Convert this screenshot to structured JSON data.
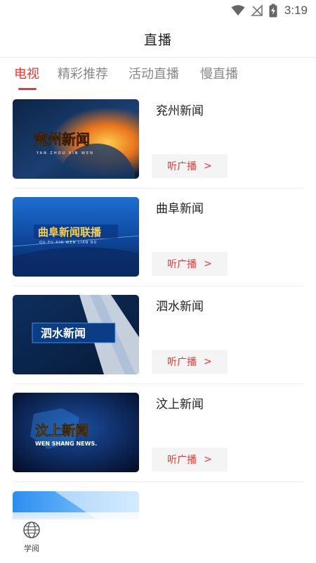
{
  "status_bar": {
    "time": "3:19",
    "icons": [
      "wifi-icon",
      "no-signal-icon",
      "battery-charging-icon"
    ]
  },
  "header": {
    "title": "直播"
  },
  "tabs": [
    {
      "label": "电视",
      "active": true
    },
    {
      "label": "精彩推荐",
      "active": false
    },
    {
      "label": "活动直播",
      "active": false
    },
    {
      "label": "慢直播",
      "active": false
    }
  ],
  "channels": [
    {
      "title": "兖州新闻",
      "thumb_caption": "兖州新闻",
      "thumb_sub": "YAN ZHOU XIN WEN",
      "button_label": "听广播",
      "button_icon": "chevron-right-icon"
    },
    {
      "title": "曲阜新闻",
      "thumb_caption": "曲阜新闻联播",
      "thumb_sub": "QU FU XIN WEN LIAN BO",
      "button_label": "听广播",
      "button_icon": "chevron-right-icon"
    },
    {
      "title": "泗水新闻",
      "thumb_caption": "泗水新闻",
      "thumb_sub": "",
      "button_label": "听广播",
      "button_icon": "chevron-right-icon"
    },
    {
      "title": "汶上新闻",
      "thumb_caption": "汶上新闻",
      "thumb_sub": "WEN SHANG NEWS.",
      "button_label": "听广播",
      "button_icon": "chevron-right-icon"
    }
  ],
  "bottom_nav": {
    "items": [
      {
        "label": "学阅",
        "icon": "globe-icon"
      }
    ]
  },
  "colors": {
    "accent": "#e53935",
    "muted": "#888888",
    "button_bg": "#f4f4f4"
  }
}
